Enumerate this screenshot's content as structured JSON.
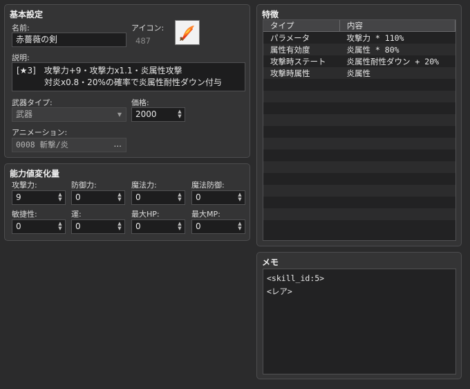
{
  "basic": {
    "title": "基本設定",
    "name_label": "名前:",
    "name_value": "赤薔薇の剣",
    "icon_label": "アイコン:",
    "icon_index": "487",
    "icon_name": "flame-sword-icon",
    "desc_label": "説明:",
    "desc_line1": "[★3]　攻撃力+9・攻撃力x1.1・炎属性攻撃",
    "desc_line2": "対炎x0.8・20%の確率で炎属性耐性ダウン付与",
    "weapon_type_label": "武器タイプ:",
    "weapon_type_value": "武器",
    "price_label": "価格:",
    "price_value": "2000",
    "animation_label": "アニメーション:",
    "animation_value": "0008 斬撃/炎",
    "animation_button": "..."
  },
  "params": {
    "title": "能力値変化量",
    "items": [
      {
        "label": "攻撃力:",
        "value": "9"
      },
      {
        "label": "防御力:",
        "value": "0"
      },
      {
        "label": "魔法力:",
        "value": "0"
      },
      {
        "label": "魔法防御:",
        "value": "0"
      },
      {
        "label": "敏捷性:",
        "value": "0"
      },
      {
        "label": "運:",
        "value": "0"
      },
      {
        "label": "最大HP:",
        "value": "0"
      },
      {
        "label": "最大MP:",
        "value": "0"
      }
    ]
  },
  "traits": {
    "title": "特徴",
    "col_type": "タイプ",
    "col_content": "内容",
    "rows": [
      {
        "type": "パラメータ",
        "content": "攻撃力 * 110%"
      },
      {
        "type": "属性有効度",
        "content": "炎属性 * 80%"
      },
      {
        "type": "攻撃時ステート",
        "content": "炎属性耐性ダウン + 20%"
      },
      {
        "type": "攻撃時属性",
        "content": "炎属性"
      },
      {
        "type": "",
        "content": ""
      },
      {
        "type": "",
        "content": ""
      },
      {
        "type": "",
        "content": ""
      },
      {
        "type": "",
        "content": ""
      },
      {
        "type": "",
        "content": ""
      },
      {
        "type": "",
        "content": ""
      },
      {
        "type": "",
        "content": ""
      },
      {
        "type": "",
        "content": ""
      },
      {
        "type": "",
        "content": ""
      },
      {
        "type": "",
        "content": ""
      },
      {
        "type": "",
        "content": ""
      },
      {
        "type": "",
        "content": ""
      },
      {
        "type": "",
        "content": ""
      }
    ]
  },
  "memo": {
    "title": "メモ",
    "line1": "<skill_id:5>",
    "line2": "<レア>"
  }
}
